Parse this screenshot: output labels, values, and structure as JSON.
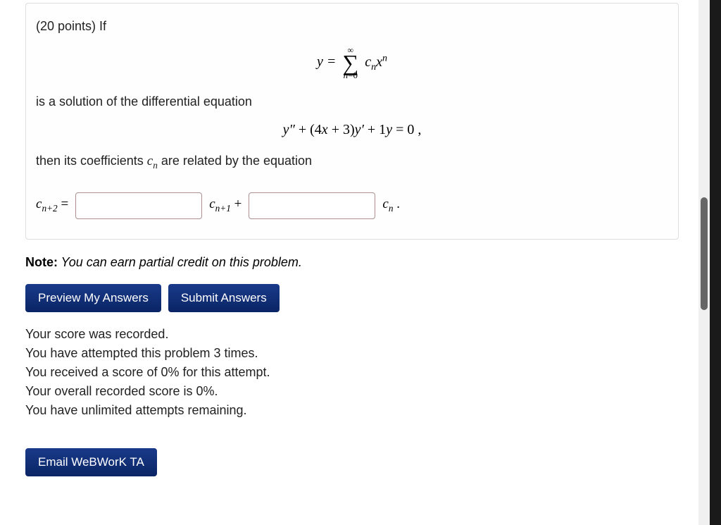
{
  "problem": {
    "intro": "(20 points) If",
    "line_is_solution": "is a solution of the differential equation",
    "line_then_coeffs_prefix": "then its coefficients ",
    "line_then_coeffs_suffix": " are related by the equation",
    "eq2": {
      "y_dprime": "y″",
      "plus1": " + (4",
      "x": "x",
      "plus3": " + 3)",
      "y_prime": "y′",
      "plus1y": " + 1",
      "y": "y",
      "eq0": " = 0 ,"
    },
    "series": {
      "y_eq": "y = ",
      "sum_upper": "∞",
      "sum_lower_n": "n",
      "sum_lower_eq0": "=0",
      "cn": "c",
      "n": "n",
      "x": "x",
      "sup_n": "n"
    },
    "answer": {
      "c_lhs": "c",
      "sub_lhs": "n+2",
      "eq": " = ",
      "c_mid": "c",
      "sub_mid": "n+1",
      "plus": " + ",
      "c_end": "c",
      "sub_end": "n",
      "dot": " ."
    }
  },
  "note": {
    "bold": "Note:",
    "text": " You can earn partial credit on this problem."
  },
  "buttons": {
    "preview": "Preview My Answers",
    "submit": "Submit Answers",
    "email": "Email WeBWorK TA"
  },
  "status": {
    "line1": "Your score was recorded.",
    "line2": "You have attempted this problem 3 times.",
    "line3": "You received a score of 0% for this attempt.",
    "line4": "Your overall recorded score is 0%.",
    "line5": "You have unlimited attempts remaining."
  },
  "inputs": {
    "answer1": "",
    "answer2": ""
  }
}
